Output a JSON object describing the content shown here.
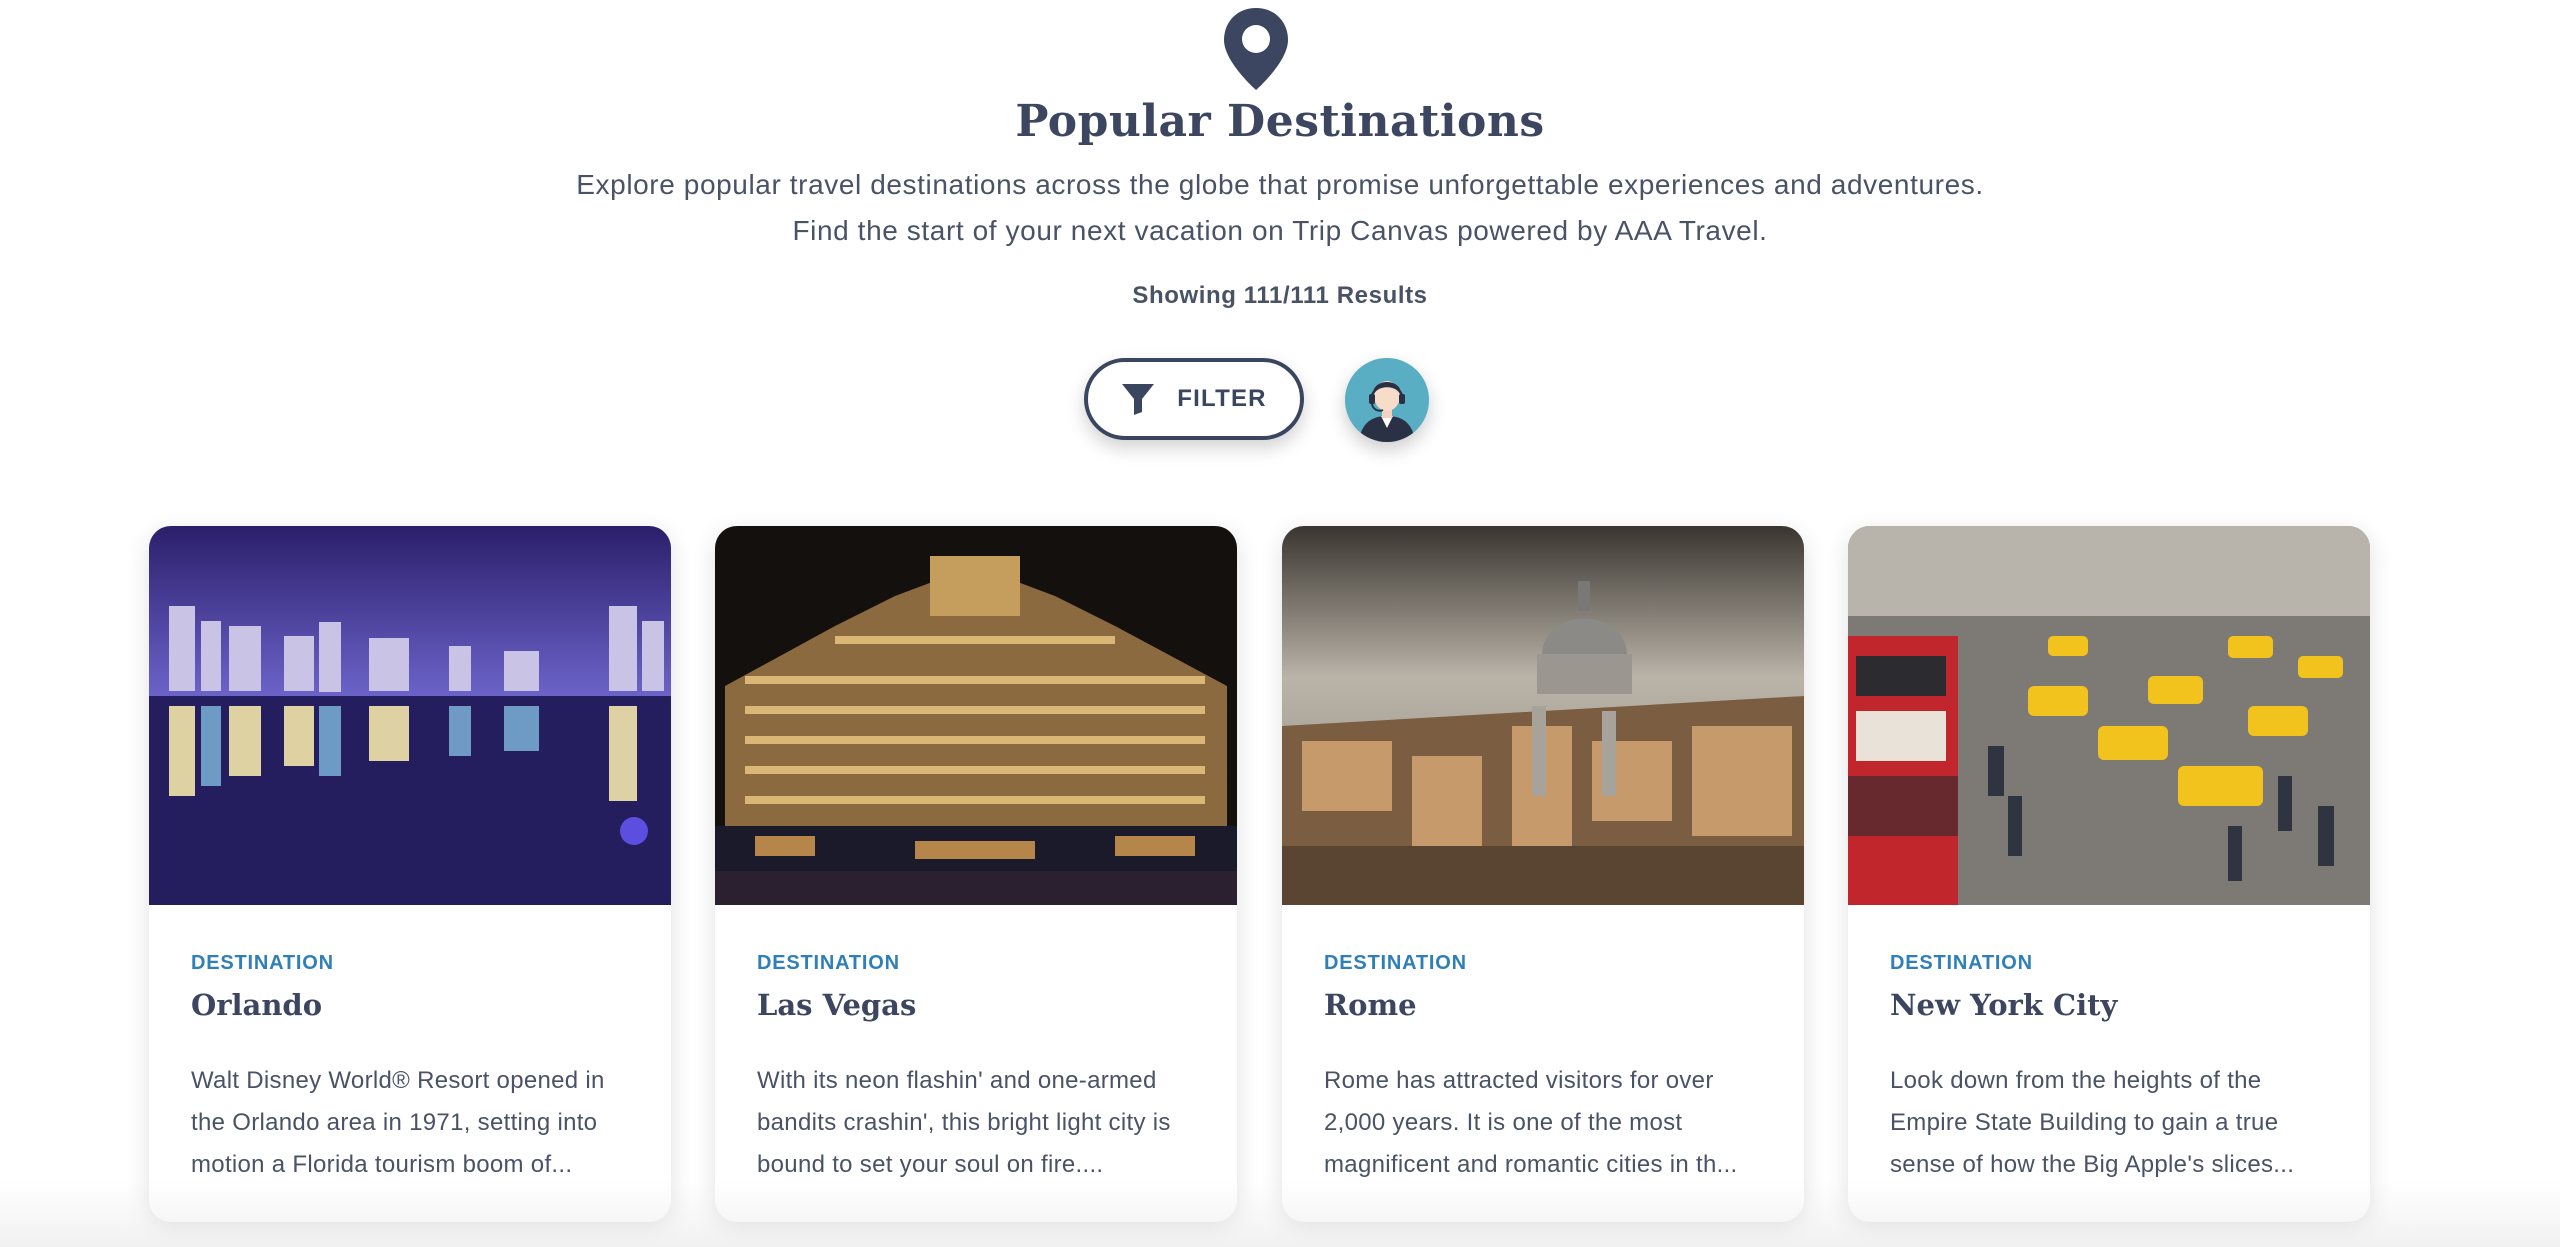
{
  "header": {
    "icon": "map-pin-icon",
    "title": "Popular Destinations",
    "subtitle_lines": [
      "Explore popular travel destinations across the globe that promise unforgettable experiences and adventures.",
      "Find the start of your next vacation on Trip Canvas powered by AAA Travel."
    ],
    "results": "Showing 111/111 Results"
  },
  "controls": {
    "filter_label": "FILTER",
    "filter_icon": "funnel-icon",
    "agent_icon": "travel-agent-avatar-icon"
  },
  "colors": {
    "primary": "#3a4660",
    "link": "#2f7fb8",
    "agent_bg": "#5aaec4"
  },
  "cards": [
    {
      "kind": "DESTINATION",
      "name": "Orlando",
      "desc": [
        "Walt Disney World® Resort opened in",
        "the Orlando area in 1971, setting into",
        "motion a Florida tourism boom of..."
      ]
    },
    {
      "kind": "DESTINATION",
      "name": "Las Vegas",
      "desc": [
        "With its neon flashin' and one-armed",
        "bandits crashin', this bright light city is",
        "bound to set your soul on fire...."
      ]
    },
    {
      "kind": "DESTINATION",
      "name": "Rome",
      "desc": [
        "Rome has attracted visitors for over",
        "2,000 years. It is one of the most",
        "magnificent and romantic cities in th..."
      ]
    },
    {
      "kind": "DESTINATION",
      "name": "New York City",
      "desc": [
        "Look down from the heights of the",
        "Empire State Building to gain a true",
        "sense of how the Big Apple's slices..."
      ]
    }
  ]
}
